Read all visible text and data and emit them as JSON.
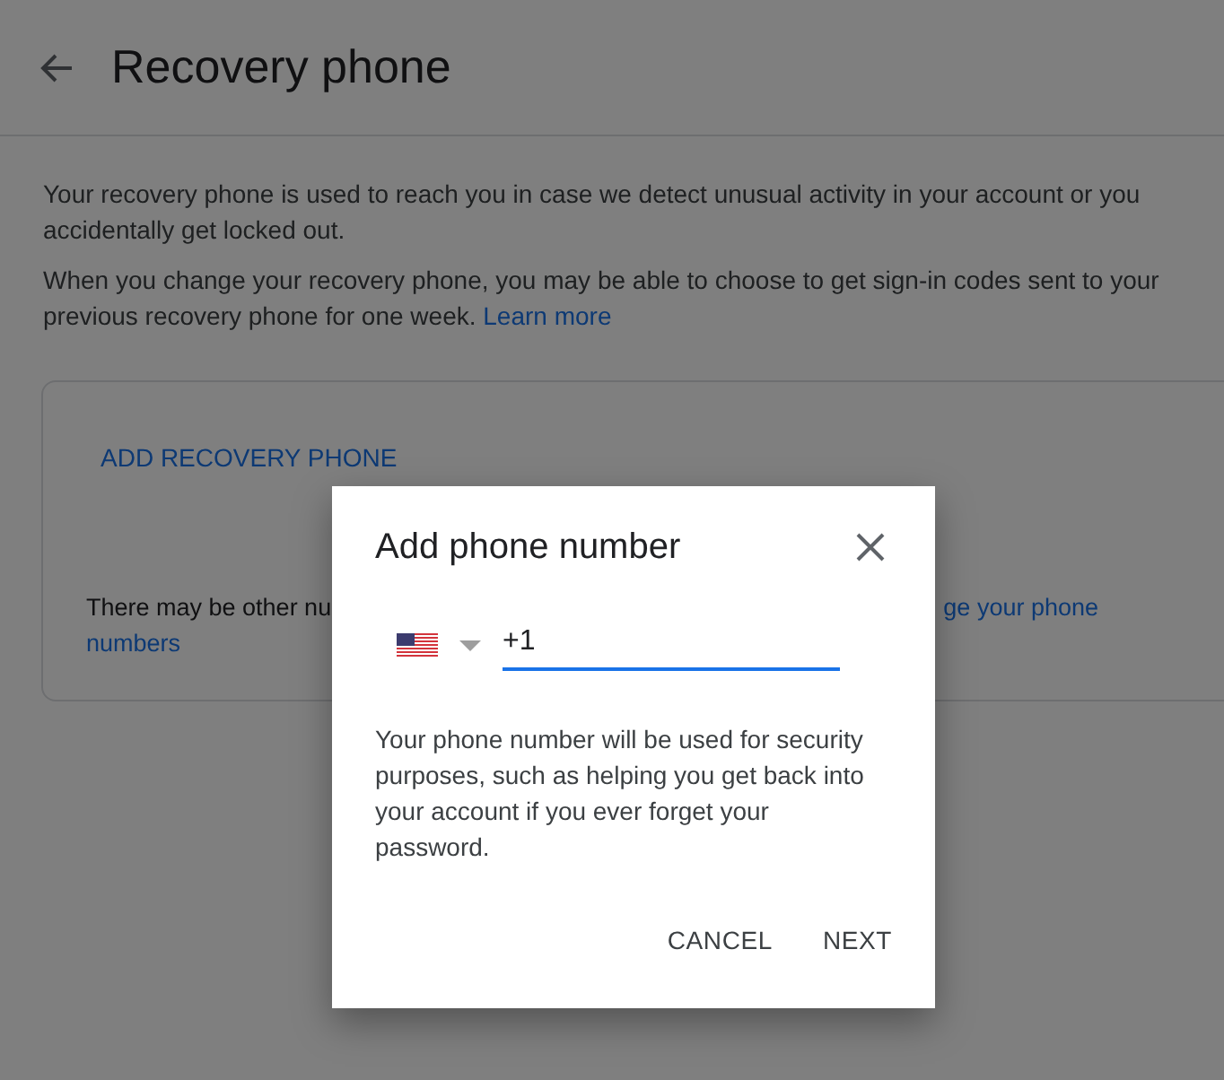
{
  "header": {
    "title": "Recovery phone"
  },
  "paragraphs": [
    {
      "text": "Your recovery phone is used to reach you in case we detect unusual activity in your account or you accidentally get locked out."
    },
    {
      "text": "When you change your recovery phone, you may be able to choose to get sign-in codes sent to your previous recovery phone for one week.",
      "link": "Learn more"
    }
  ],
  "card": {
    "action": "ADD RECOVERY PHONE",
    "note_start": "There may be other nu",
    "note_link_lines": [
      "ge your phone",
      "numbers"
    ]
  },
  "dialog": {
    "title": "Add phone number",
    "phone": {
      "value": "+1"
    },
    "description": "Your phone number will be used for security purposes, such as helping you get back into your account if you ever forget your password.",
    "buttons": [
      "CANCEL",
      "NEXT"
    ]
  }
}
